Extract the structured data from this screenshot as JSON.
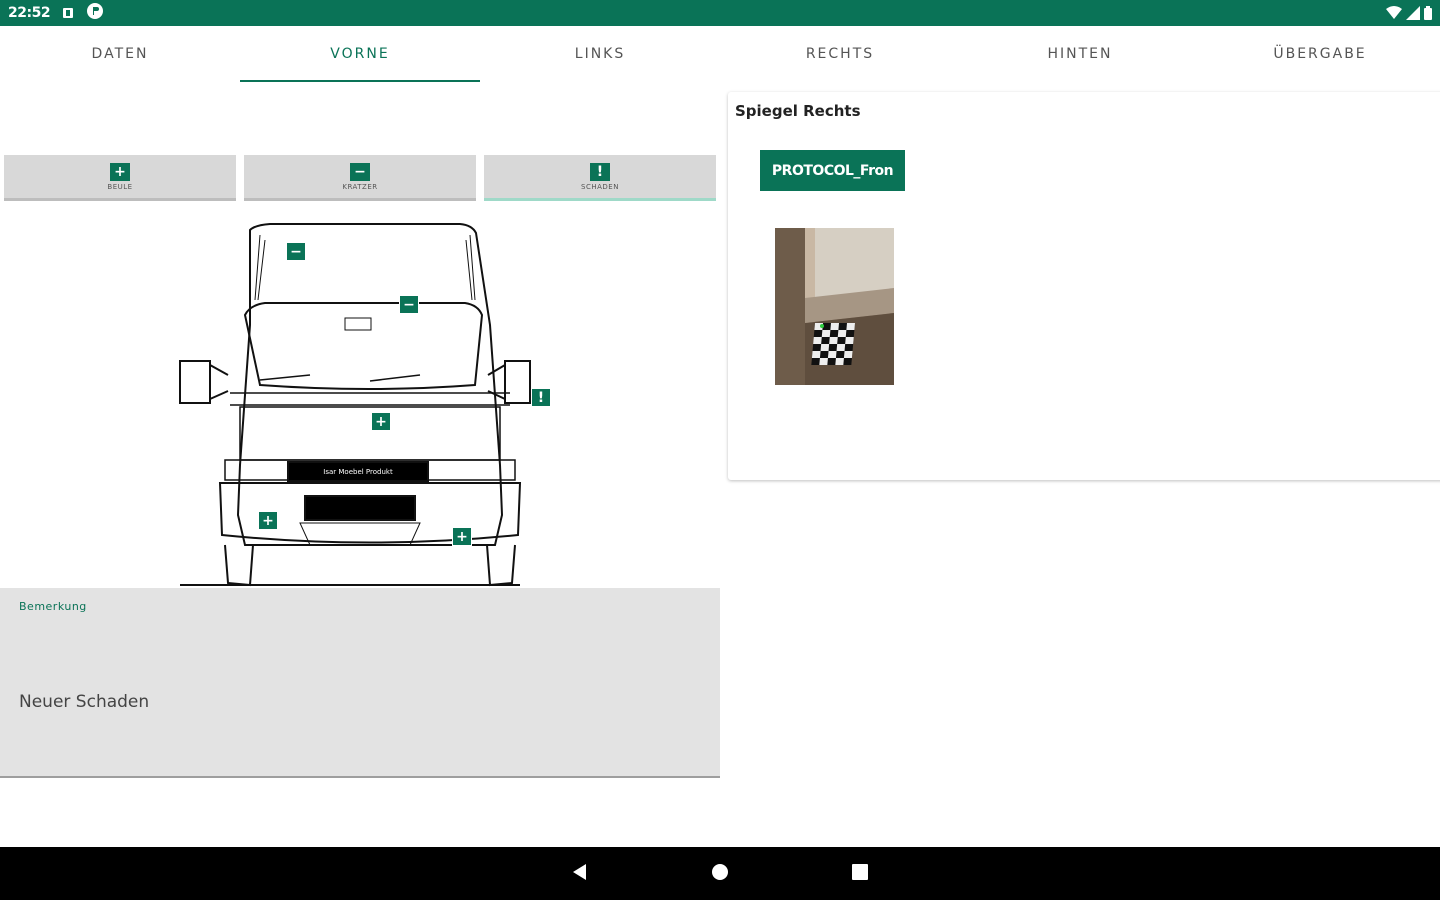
{
  "status_bar": {
    "time": "22:52"
  },
  "tabs": [
    {
      "label": "DATEN",
      "active": false
    },
    {
      "label": "VORNE",
      "active": true
    },
    {
      "label": "LINKS",
      "active": false
    },
    {
      "label": "RECHTS",
      "active": false
    },
    {
      "label": "HINTEN",
      "active": false
    },
    {
      "label": "ÜBERGABE",
      "active": false
    }
  ],
  "tools": [
    {
      "symbol": "+",
      "label": "BEULE"
    },
    {
      "symbol": "−",
      "label": "KRATZER"
    },
    {
      "symbol": "!",
      "label": "SCHADEN"
    }
  ],
  "vehicle": {
    "plate_text": "Isar Moebel Produkt"
  },
  "markers": [
    "−",
    "−",
    "!",
    "+",
    "+",
    "+"
  ],
  "remark": {
    "label": "Bemerkung",
    "value": "Neuer Schaden"
  },
  "detail": {
    "title": "Spiegel Rechts",
    "protocol_button": "PROTOCOL_Fron"
  },
  "colors": {
    "primary": "#0a7357"
  }
}
